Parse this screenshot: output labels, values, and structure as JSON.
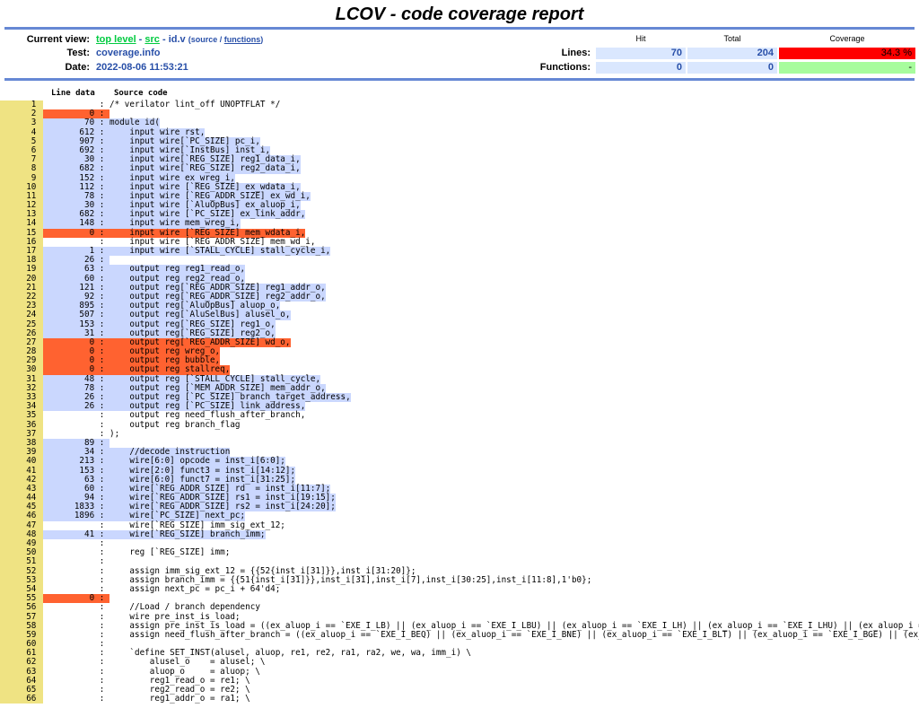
{
  "title": "LCOV - code coverage report",
  "header": {
    "current_view_label": "Current view:",
    "crumb_top": "top level",
    "sep1": " - ",
    "crumb_src": "src",
    "sep2": " - ",
    "file": "id.v",
    "paren_open": "(source / ",
    "functions_link": "functions",
    "paren_close": ")",
    "test_label": "Test:",
    "test_value": "coverage.info",
    "date_label": "Date:",
    "date_value": "2022-08-06 11:53:21",
    "col_hit": "Hit",
    "col_total": "Total",
    "col_coverage": "Coverage",
    "lines_label": "Lines:",
    "lines_hit": "70",
    "lines_total": "204",
    "lines_cov": "34.3 %",
    "functions_label": "Functions:",
    "func_hit": "0",
    "func_total": "0",
    "func_cov": "-"
  },
  "source_header": {
    "line_data": "Line data",
    "source_code": "Source code"
  },
  "lines": [
    {
      "n": "1",
      "c": "",
      "t": "/* verilator lint_off UNOPTFLAT */",
      "s": "none"
    },
    {
      "n": "2",
      "c": "0",
      "t": "",
      "s": "miss"
    },
    {
      "n": "3",
      "c": "70",
      "t": "module id(",
      "s": "hit"
    },
    {
      "n": "4",
      "c": "612",
      "t": "    input wire rst,",
      "s": "hit"
    },
    {
      "n": "5",
      "c": "907",
      "t": "    input wire[`PC_SIZE] pc_i,",
      "s": "hit"
    },
    {
      "n": "6",
      "c": "692",
      "t": "    input wire[`InstBus] inst_i,",
      "s": "hit"
    },
    {
      "n": "7",
      "c": "30",
      "t": "    input wire[`REG_SIZE] reg1_data_i,",
      "s": "hit"
    },
    {
      "n": "8",
      "c": "682",
      "t": "    input wire[`REG_SIZE] reg2_data_i,",
      "s": "hit"
    },
    {
      "n": "9",
      "c": "152",
      "t": "    input wire ex_wreg_i,",
      "s": "hit"
    },
    {
      "n": "10",
      "c": "112",
      "t": "    input wire [`REG_SIZE] ex_wdata_i,",
      "s": "hit"
    },
    {
      "n": "11",
      "c": "78",
      "t": "    input wire [`REG_ADDR_SIZE] ex_wd_i,",
      "s": "hit"
    },
    {
      "n": "12",
      "c": "30",
      "t": "    input wire [`AluOpBus] ex_aluop_i,",
      "s": "hit"
    },
    {
      "n": "13",
      "c": "682",
      "t": "    input wire [`PC_SIZE] ex_link_addr,",
      "s": "hit"
    },
    {
      "n": "14",
      "c": "148",
      "t": "    input wire mem_wreg_i,",
      "s": "hit"
    },
    {
      "n": "15",
      "c": "0",
      "t": "    input wire [`REG_SIZE] mem_wdata_i,",
      "s": "miss"
    },
    {
      "n": "16",
      "c": "",
      "t": "    input wire [`REG_ADDR_SIZE] mem_wd_i,",
      "s": "none"
    },
    {
      "n": "17",
      "c": "1",
      "t": "    input wire [`STALL_CYCLE] stall_cycle_i,",
      "s": "hit"
    },
    {
      "n": "18",
      "c": "26",
      "t": "",
      "s": "hit"
    },
    {
      "n": "19",
      "c": "63",
      "t": "    output reg reg1_read_o,",
      "s": "hit"
    },
    {
      "n": "20",
      "c": "60",
      "t": "    output reg reg2_read_o,",
      "s": "hit"
    },
    {
      "n": "21",
      "c": "121",
      "t": "    output reg[`REG_ADDR_SIZE] reg1_addr_o,",
      "s": "hit"
    },
    {
      "n": "22",
      "c": "92",
      "t": "    output reg[`REG_ADDR_SIZE] reg2_addr_o,",
      "s": "hit"
    },
    {
      "n": "23",
      "c": "895",
      "t": "    output reg[`AluOpBus] aluop_o,",
      "s": "hit"
    },
    {
      "n": "24",
      "c": "507",
      "t": "    output reg[`AluSelBus] alusel_o,",
      "s": "hit"
    },
    {
      "n": "25",
      "c": "153",
      "t": "    output reg[`REG_SIZE] reg1_o,",
      "s": "hit"
    },
    {
      "n": "26",
      "c": "31",
      "t": "    output reg[`REG_SIZE] reg2_o,",
      "s": "hit"
    },
    {
      "n": "27",
      "c": "0",
      "t": "    output reg[`REG_ADDR_SIZE] wd_o,",
      "s": "miss"
    },
    {
      "n": "28",
      "c": "0",
      "t": "    output reg wreg_o,",
      "s": "miss"
    },
    {
      "n": "29",
      "c": "0",
      "t": "    output reg bubble,",
      "s": "miss"
    },
    {
      "n": "30",
      "c": "0",
      "t": "    output reg stallreq,",
      "s": "miss"
    },
    {
      "n": "31",
      "c": "48",
      "t": "    output reg [`STALL_CYCLE] stall_cycle,",
      "s": "hit"
    },
    {
      "n": "32",
      "c": "78",
      "t": "    output reg [`MEM_ADDR_SIZE] mem_addr_o,",
      "s": "hit"
    },
    {
      "n": "33",
      "c": "26",
      "t": "    output reg [`PC_SIZE] branch_target_address,",
      "s": "hit"
    },
    {
      "n": "34",
      "c": "26",
      "t": "    output reg [`PC_SIZE] link_address,",
      "s": "hit"
    },
    {
      "n": "35",
      "c": "",
      "t": "    output reg need_flush_after_branch,",
      "s": "none"
    },
    {
      "n": "36",
      "c": "",
      "t": "    output reg branch_flag",
      "s": "none"
    },
    {
      "n": "37",
      "c": "",
      "t": ");",
      "s": "none"
    },
    {
      "n": "38",
      "c": "89",
      "t": "",
      "s": "hit"
    },
    {
      "n": "39",
      "c": "34",
      "t": "    //decode instruction",
      "s": "hit"
    },
    {
      "n": "40",
      "c": "213",
      "t": "    wire[6:0] opcode = inst_i[6:0];",
      "s": "hit"
    },
    {
      "n": "41",
      "c": "153",
      "t": "    wire[2:0] funct3 = inst_i[14:12];",
      "s": "hit"
    },
    {
      "n": "42",
      "c": "63",
      "t": "    wire[6:0] funct7 = inst_i[31:25];",
      "s": "hit"
    },
    {
      "n": "43",
      "c": "60",
      "t": "    wire[`REG_ADDR_SIZE] rd  = inst_i[11:7];",
      "s": "hit"
    },
    {
      "n": "44",
      "c": "94",
      "t": "    wire[`REG_ADDR_SIZE] rs1 = inst_i[19:15];",
      "s": "hit"
    },
    {
      "n": "45",
      "c": "1833",
      "t": "    wire[`REG_ADDR_SIZE] rs2 = inst_i[24:20];",
      "s": "hit"
    },
    {
      "n": "46",
      "c": "1896",
      "t": "    wire[`PC_SIZE] next_pc;",
      "s": "hit"
    },
    {
      "n": "47",
      "c": "",
      "t": "    wire[`REG_SIZE] imm_sig_ext_12;",
      "s": "none"
    },
    {
      "n": "48",
      "c": "41",
      "t": "    wire[`REG_SIZE] branch_imm;",
      "s": "hit"
    },
    {
      "n": "49",
      "c": "",
      "t": "",
      "s": "none"
    },
    {
      "n": "50",
      "c": "",
      "t": "    reg [`REG_SIZE] imm;",
      "s": "none"
    },
    {
      "n": "51",
      "c": "",
      "t": "",
      "s": "none"
    },
    {
      "n": "52",
      "c": "",
      "t": "    assign imm_sig_ext_12 = {{52{inst_i[31]}},inst_i[31:20]};",
      "s": "none"
    },
    {
      "n": "53",
      "c": "",
      "t": "    assign branch_imm = {{51{inst_i[31]}},inst_i[31],inst_i[7],inst_i[30:25],inst_i[11:8],1'b0};",
      "s": "none"
    },
    {
      "n": "54",
      "c": "",
      "t": "    assign next_pc = pc_i + 64'd4;",
      "s": "none"
    },
    {
      "n": "55",
      "c": "0",
      "t": "",
      "s": "miss"
    },
    {
      "n": "56",
      "c": "",
      "t": "    //Load / branch dependency",
      "s": "none"
    },
    {
      "n": "57",
      "c": "",
      "t": "    wire pre_inst_is_load;",
      "s": "none"
    },
    {
      "n": "58",
      "c": "",
      "t": "    assign pre_inst_is_load = ((ex_aluop_i == `EXE_I_LB) || (ex_aluop_i == `EXE_I_LBU) || (ex_aluop_i == `EXE_I_LH) || (ex_aluop_i == `EXE_I_LHU) || (ex_aluop_i == `EXE",
      "s": "none"
    },
    {
      "n": "59",
      "c": "",
      "t": "    assign need_flush_after_branch = ((ex_aluop_i == `EXE_I_BEQ) || (ex_aluop_i == `EXE_I_BNE) || (ex_aluop_i == `EXE_I_BLT) || (ex_aluop_i == `EXE_I_BGE) || (ex_aluop_",
      "s": "none"
    },
    {
      "n": "60",
      "c": "",
      "t": "",
      "s": "none"
    },
    {
      "n": "61",
      "c": "",
      "t": "    `define SET_INST(alusel, aluop, re1, re2, ra1, ra2, we, wa, imm_i) \\",
      "s": "none"
    },
    {
      "n": "62",
      "c": "",
      "t": "        alusel_o    = alusel; \\",
      "s": "none"
    },
    {
      "n": "63",
      "c": "",
      "t": "        aluop_o     = aluop; \\",
      "s": "none"
    },
    {
      "n": "64",
      "c": "",
      "t": "        reg1_read_o = re1; \\",
      "s": "none"
    },
    {
      "n": "65",
      "c": "",
      "t": "        reg2_read_o = re2; \\",
      "s": "none"
    },
    {
      "n": "66",
      "c": "",
      "t": "        reg1_addr_o = ra1; \\",
      "s": "none"
    }
  ]
}
